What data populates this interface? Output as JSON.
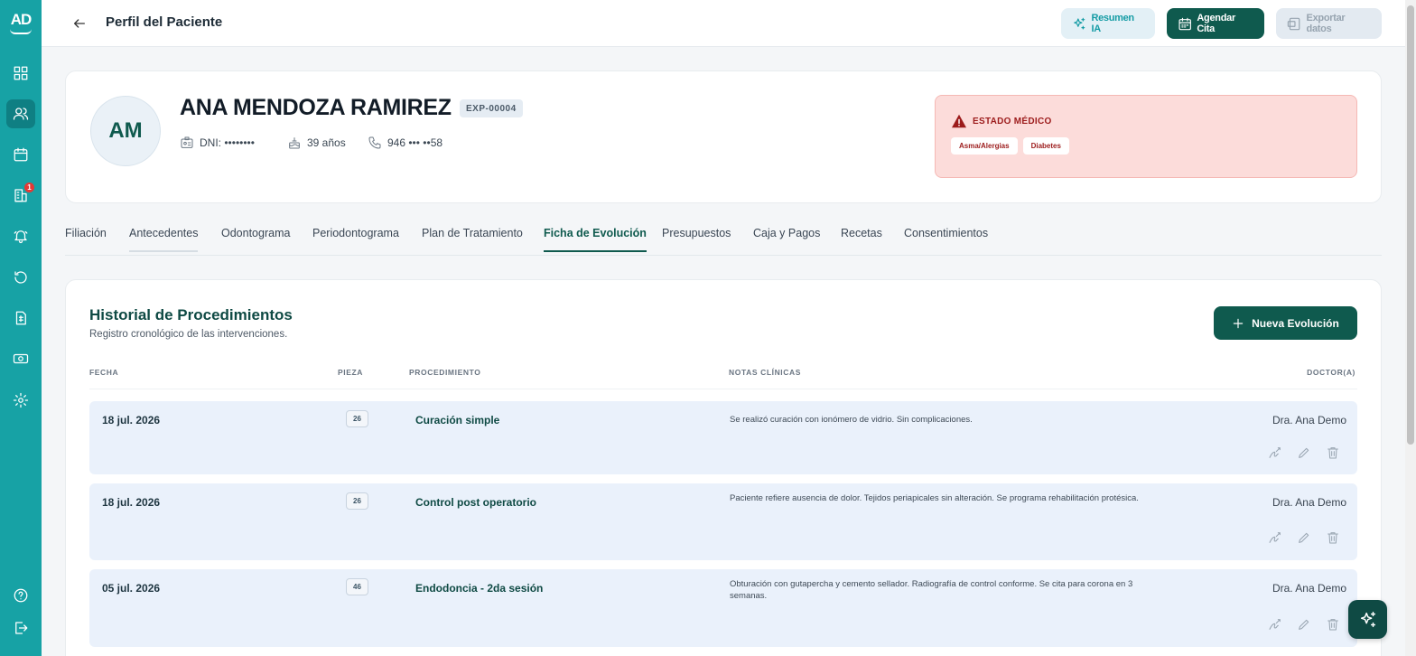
{
  "app": {
    "logo_text": "AD"
  },
  "sidebar": {
    "notification_count": "1",
    "items": [
      {
        "icon": "grid-icon"
      },
      {
        "icon": "users-icon",
        "active": true
      },
      {
        "icon": "calendar-icon"
      },
      {
        "icon": "building-icon"
      },
      {
        "icon": "bell-icon"
      },
      {
        "icon": "history-icon"
      },
      {
        "icon": "invoice-icon"
      },
      {
        "icon": "cash-icon"
      },
      {
        "icon": "gear-icon"
      },
      {
        "icon": "help-icon"
      },
      {
        "icon": "logout-icon"
      }
    ]
  },
  "header": {
    "title": "Perfil del Paciente",
    "resumen_label": "Resumen IA",
    "agendar_label": "Agendar Cita",
    "exportar_label": "Exportar datos"
  },
  "patient": {
    "initials": "AM",
    "name": "ANA MENDOZA RAMIREZ",
    "expediente": "EXP-00004",
    "dni": "DNI: ••••••••",
    "age": "39 años",
    "phone": "946 ••• ••58"
  },
  "medical_status": {
    "title": "ESTADO MÉDICO",
    "tags": [
      "Asma/Alergias",
      "Diabetes"
    ],
    "color": "#9c1b1b"
  },
  "tabs": [
    "Filiación",
    "Antecedentes",
    "Odontograma",
    "Periodontograma",
    "Plan de Tratamiento",
    "Ficha de Evolución",
    "Presupuestos",
    "Caja y Pagos",
    "Recetas",
    "Consentimientos"
  ],
  "active_tab": "Ficha de Evolución",
  "history": {
    "title": "Historial de Procedimientos",
    "subtitle": "Registro cronológico de las intervenciones.",
    "new_button": "Nueva Evolución",
    "columns": {
      "date": "FECHA",
      "piece": "PIEZA",
      "procedure": "PROCEDIMIENTO",
      "notes": "NOTAS CLÍNICAS",
      "doctor": "DOCTOR(A)"
    },
    "rows": [
      {
        "date": "18 jul. 2026",
        "piece": "26",
        "procedure": "Curación simple",
        "notes": "Se realizó curación con ionómero de vidrio. Sin complicaciones.",
        "doctor": "Dra. Ana Demo"
      },
      {
        "date": "18 jul. 2026",
        "piece": "26",
        "procedure": "Control post operatorio",
        "notes": "Paciente refiere ausencia de dolor. Tejidos periapicales sin alteración. Se programa rehabilitación protésica.",
        "doctor": "Dra. Ana Demo"
      },
      {
        "date": "05 jul. 2026",
        "piece": "46",
        "procedure": "Endodoncia - 2da sesión",
        "notes": "Obturación con gutapercha y cemento sellador. Radiografía de control conforme. Se cita para corona en 3 semanas.",
        "doctor": "Dra. Ana Demo"
      }
    ]
  },
  "colors": {
    "sidebar": "#17a2a5",
    "primary": "#0f5a4e",
    "alert_bg": "#fcdcda",
    "row_bg": "#eaf1fb"
  }
}
